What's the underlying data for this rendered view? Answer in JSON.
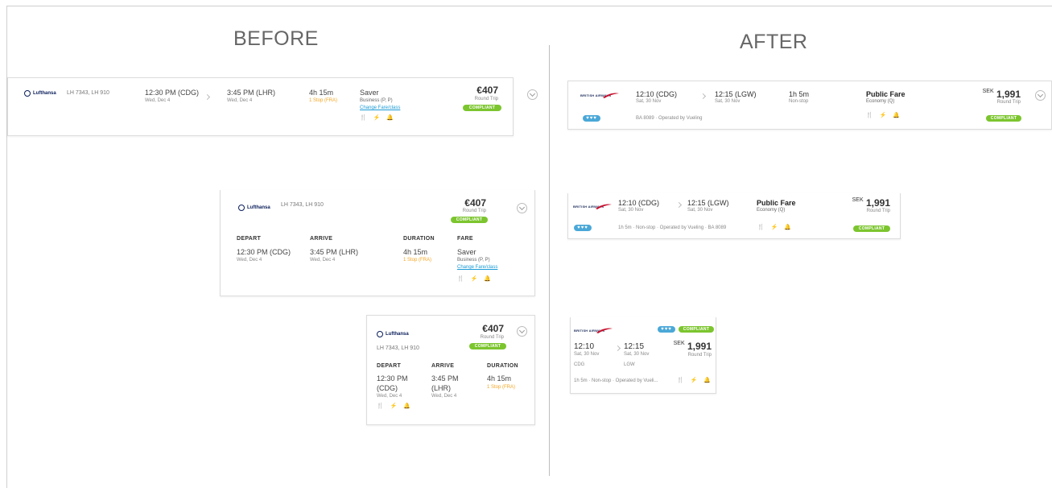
{
  "headings": {
    "before": "BEFORE",
    "after": "AFTER"
  },
  "amenities_icons": [
    "meal-icon",
    "wifi-icon",
    "power-icon"
  ],
  "amenities_glyphs": "🍴 ⚡ 🔔",
  "colors": {
    "compliant": "#7cc52f",
    "link": "#1a9bd6",
    "stop": "#f5a623",
    "preference": "#4aa8d8"
  },
  "before": {
    "airline": "Lufthansa",
    "flight_numbers": "LH 7343, LH 910",
    "depart_time": "12:30 PM (CDG)",
    "depart_time_short": "12:30 PM",
    "depart_airport_short": "(CDG)",
    "depart_date": "Wed, Dec 4",
    "arrive_time": "3:45 PM (LHR)",
    "arrive_time_short": "3:45 PM",
    "arrive_airport_short": "(LHR)",
    "arrive_date": "Wed, Dec 4",
    "duration": "4h 15m",
    "stops": "1 Stop (FRA)",
    "fare_name": "Saver",
    "fare_class": "Business (P, P)",
    "change_fare": "Change Fare/class",
    "price": "€407",
    "trip_type": "Round Trip",
    "compliance": "COMPLIANT",
    "labels": {
      "depart": "DEPART",
      "arrive": "ARRIVE",
      "duration": "DURATION",
      "fare": "FARE"
    }
  },
  "after": {
    "airline": "BRITISH AIRWAYS",
    "preference": "♥♥♥",
    "depart_time": "12:10 (CDG)",
    "depart_time_short": "12:10",
    "depart_date": "Sat, 30 Nov",
    "depart_airport": "CDG",
    "arrive_time": "12:15 (LGW)",
    "arrive_time_short": "12:15",
    "arrive_date": "Sat, 30 Nov",
    "arrive_airport": "LGW",
    "duration": "1h 5m",
    "stops": "Non-stop",
    "fare_name": "Public Fare",
    "fare_class": "Economy (Q)",
    "currency": "SEK",
    "price": "1,991",
    "trip_type": "Round Trip",
    "compliance": "COMPLIANT",
    "operated_full": "BA 8089 · Operated by Vueling",
    "operated_medium": "1h 5m · Non-stop · Operated by Vueling · BA 8089",
    "operated_short": "1h 5m · Non-stop · Operated by Vueli..."
  }
}
